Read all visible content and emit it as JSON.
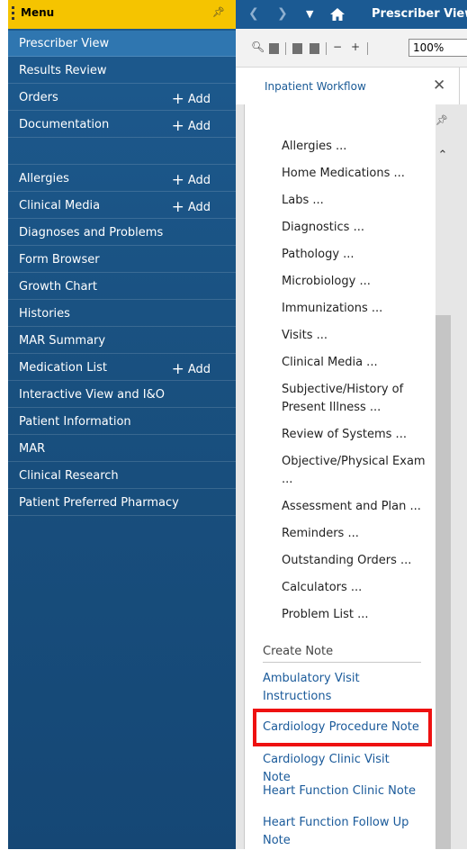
{
  "menu": {
    "title": "Menu",
    "add_label": "Add",
    "items": [
      {
        "label": "Prescriber View",
        "selected": true
      },
      {
        "label": "Results Review"
      },
      {
        "label": "Orders",
        "add": true
      },
      {
        "label": "Documentation",
        "add": true
      },
      {
        "label": ""
      },
      {
        "label": "Allergies",
        "add": true
      },
      {
        "label": "Clinical Media",
        "add": true
      },
      {
        "label": "Diagnoses and Problems"
      },
      {
        "label": "Form Browser"
      },
      {
        "label": "Growth Chart"
      },
      {
        "label": "Histories"
      },
      {
        "label": "MAR Summary"
      },
      {
        "label": "Medication List",
        "add": true
      },
      {
        "label": "Interactive View and I&O"
      },
      {
        "label": "Patient Information"
      },
      {
        "label": "MAR"
      },
      {
        "label": "Clinical Research"
      },
      {
        "label": "Patient Preferred Pharmacy"
      }
    ]
  },
  "topbar": {
    "title": "Prescriber View"
  },
  "toolbar": {
    "zoom": "100%"
  },
  "tab": {
    "label": "Inpatient Workflow"
  },
  "workflow": {
    "links": [
      "Allergies ...",
      "Home Medications ...",
      "Labs ...",
      "Diagnostics ...",
      "Pathology ...",
      "Microbiology ...",
      "Immunizations ...",
      "Visits ...",
      "Clinical Media ...",
      "Subjective/History of Present Illness ...",
      "Review of Systems ...",
      "Objective/Physical Exam ...",
      "Assessment and Plan ...",
      "Reminders ...",
      "Outstanding Orders ...",
      "Calculators ...",
      "Problem List ..."
    ],
    "create_note_label": "Create Note",
    "notes": [
      "Ambulatory Visit Instructions",
      "Cardiology Procedure Note",
      "Cardiology Clinic Visit Note",
      "Heart Function Clinic Note",
      "Heart Function Follow Up Note"
    ]
  },
  "colors": {
    "menu_header": "#f5c400",
    "menu_bg": "#1d5a8f",
    "highlight": "#ee1111",
    "link_blue": "#1a5a9a"
  }
}
